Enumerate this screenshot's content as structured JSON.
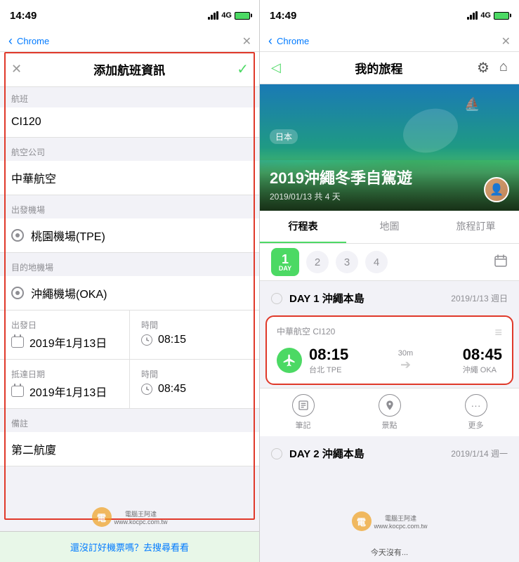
{
  "app": {
    "title": "14:49 Chrome"
  },
  "left_screen": {
    "status": {
      "time": "14:49",
      "signal": "4G",
      "battery": "charging"
    },
    "chrome_label": "Chrome",
    "form": {
      "title": "添加航班資訊",
      "close_btn": "✕",
      "check_btn": "✓",
      "fields": {
        "flight_label": "航班",
        "flight_value": "CI120",
        "airline_label": "航空公司",
        "airline_value": "中華航空",
        "departure_airport_label": "出發機場",
        "departure_airport_value": "桃園機場(TPE)",
        "arrival_airport_label": "目的地機場",
        "arrival_airport_value": "沖繩機場(OKA)",
        "departure_date_label": "出發日",
        "departure_date_value": "2019年1月13日",
        "departure_time_label": "時間",
        "departure_time_value": "08:15",
        "arrival_date_label": "抵達日期",
        "arrival_date_value": "2019年1月13日",
        "arrival_time_label": "時間",
        "arrival_time_value": "08:45",
        "notes_label": "備註",
        "notes_value": "第二航廈"
      }
    },
    "ad_text": "還沒訂好機票嗎？去搜尋看看"
  },
  "right_screen": {
    "status": {
      "time": "14:49",
      "signal": "4G",
      "battery": "charging"
    },
    "chrome_label": "Chrome",
    "header": {
      "title": "我的旅程",
      "back_icon": "◁",
      "settings_icon": "⚙",
      "home_icon": "⌂"
    },
    "hero": {
      "title": "2019沖繩冬季自駕遊",
      "subtitle": "2019/01/13 共 4 天",
      "tag": "日本"
    },
    "tabs": [
      {
        "label": "行程表",
        "active": true
      },
      {
        "label": "地圖",
        "active": false
      },
      {
        "label": "旅程訂單",
        "active": false
      }
    ],
    "days": [
      {
        "num": "1",
        "label": "DAY"
      },
      {
        "num": "2",
        "label": ""
      },
      {
        "num": "3",
        "label": ""
      },
      {
        "num": "4",
        "label": ""
      }
    ],
    "day1": {
      "title": "DAY 1  沖繩本島",
      "date": "2019/1/13 週日"
    },
    "flight_card": {
      "airline": "中華航空 CI120",
      "departure_time": "08:15",
      "departure_city": "台北 TPE",
      "arrival_time": "08:45",
      "arrival_city": "沖繩 OKA",
      "duration": "30m"
    },
    "bottom_icons": [
      {
        "icon": "≡",
        "label": "筆記"
      },
      {
        "icon": "📍",
        "label": "景點"
      },
      {
        "icon": "•••",
        "label": "更多"
      }
    ],
    "day2": {
      "title": "DAY 2  沖繩本島",
      "date": "2019/1/14 週一"
    },
    "watermark_url": "www.kocpc.com.tw"
  }
}
